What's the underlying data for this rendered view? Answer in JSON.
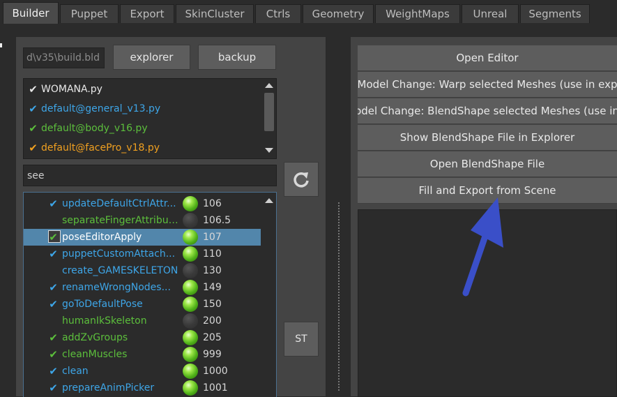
{
  "tabs": [
    {
      "label": "Builder",
      "active": true
    },
    {
      "label": "Puppet",
      "active": false
    },
    {
      "label": "Export",
      "active": false
    },
    {
      "label": "SkinCluster",
      "active": false
    },
    {
      "label": "Ctrls",
      "active": false
    },
    {
      "label": "Geometry",
      "active": false
    },
    {
      "label": "WeightMaps",
      "active": false
    },
    {
      "label": "Unreal",
      "active": false
    },
    {
      "label": "Segments",
      "active": false
    }
  ],
  "builder": {
    "path_value": "d\\v35\\build.bld",
    "explorer_label": "explorer",
    "backup_label": "backup",
    "files": [
      {
        "name": "WOMANA.py",
        "color": "#e8e8e8",
        "check_color": "#e8e8e8"
      },
      {
        "name": "default@general_v13.py",
        "color": "#3ea6e8",
        "check_color": "#3ea6e8"
      },
      {
        "name": "default@body_v16.py",
        "color": "#5cbf3c",
        "check_color": "#5cbf3c"
      },
      {
        "name": "default@facePro_v18.py",
        "color": "#f0a020",
        "check_color": "#f0a020"
      }
    ],
    "search_value": "see",
    "st_label": "ST",
    "tasks": [
      {
        "name": "updateDefaultCtrlAttr...",
        "number": "106",
        "checked": true,
        "color": "#3ea6e8",
        "status": "on"
      },
      {
        "name": "separateFingerAttributes",
        "number": "106.5",
        "checked": false,
        "color": "#5cbf3c",
        "status": "off"
      },
      {
        "name": "poseEditorApply",
        "number": "107",
        "checked": true,
        "color": "#ffffff",
        "status": "on",
        "selected": true
      },
      {
        "name": "puppetCustomAttach...",
        "number": "110",
        "checked": true,
        "color": "#3ea6e8",
        "status": "on"
      },
      {
        "name": "create_GAMESKELETON",
        "number": "130",
        "checked": false,
        "color": "#3ea6e8",
        "status": "off"
      },
      {
        "name": "renameWrongNodes...",
        "number": "149",
        "checked": true,
        "color": "#3ea6e8",
        "status": "on"
      },
      {
        "name": "goToDefaultPose",
        "number": "150",
        "checked": true,
        "color": "#3ea6e8",
        "status": "on"
      },
      {
        "name": "humanIkSkeleton",
        "number": "200",
        "checked": false,
        "color": "#5cbf3c",
        "status": "off"
      },
      {
        "name": "addZvGroups",
        "number": "205",
        "checked": true,
        "color": "#5cbf3c",
        "status": "on"
      },
      {
        "name": "cleanMuscles",
        "number": "999",
        "checked": true,
        "color": "#5cbf3c",
        "status": "on"
      },
      {
        "name": "clean",
        "number": "1000",
        "checked": true,
        "color": "#3ea6e8",
        "status": "on"
      },
      {
        "name": "prepareAnimPicker",
        "number": "1001",
        "checked": true,
        "color": "#3ea6e8",
        "status": "on"
      }
    ]
  },
  "right_buttons": [
    "Open Editor",
    "Model Change: Warp selected Meshes (use in exp",
    "Model Change: BlendShape selected Meshes (use in e",
    "Show BlendShape File in Explorer",
    "Open BlendShape File",
    "Fill and Export from Scene"
  ],
  "icons": {
    "refresh": "refresh-icon",
    "check": "check-icon",
    "annotation": "arrow-annotation"
  },
  "colors": {
    "accent_blue": "#3ea6e8",
    "accent_green": "#5cbf3c",
    "accent_orange": "#f0a020",
    "selection": "#5286ab",
    "annotation_arrow": "#3a4fc8"
  }
}
